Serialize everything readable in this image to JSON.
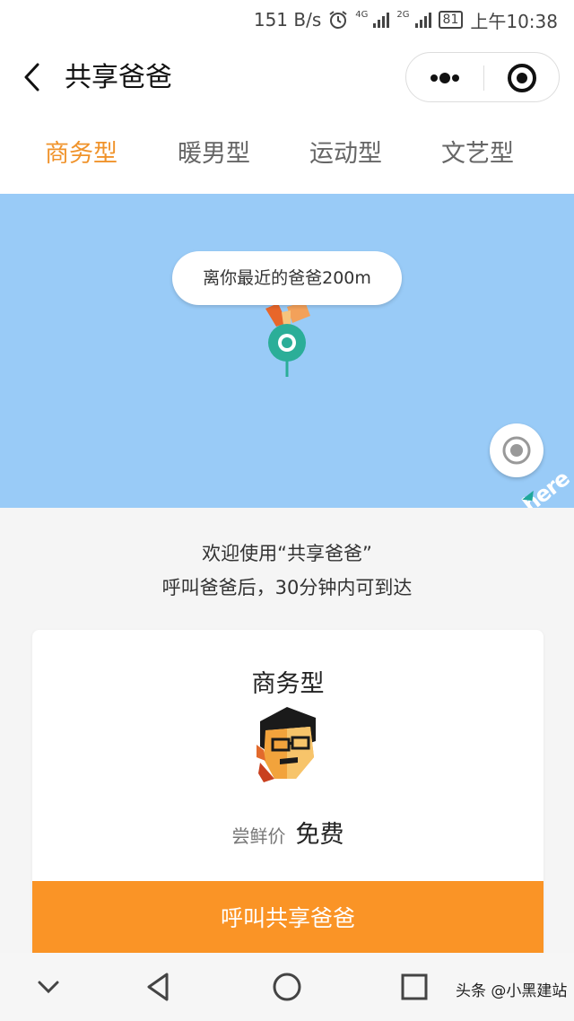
{
  "status_bar": {
    "speed": "151 B/s",
    "net1": "4G",
    "net2": "2G",
    "battery": "81",
    "time": "上午10:38"
  },
  "header": {
    "title": "共享爸爸",
    "icons": [
      "back-icon",
      "more-icon",
      "target-icon"
    ]
  },
  "tabs": [
    {
      "label": "商务型",
      "active": true
    },
    {
      "label": "暖男型",
      "active": false
    },
    {
      "label": "运动型",
      "active": false
    },
    {
      "label": "文艺型",
      "active": false
    }
  ],
  "map": {
    "bubble_text": "离你最近的爸爸200m",
    "logo_text": "here",
    "background_color": "#99cbf7",
    "marker_color": "#2bae98"
  },
  "welcome": {
    "line1": "欢迎使用“共享爸爸”",
    "line2": "呼叫爸爸后，30分钟内可到达"
  },
  "card": {
    "type_label": "商务型",
    "price_label": "尝鲜价",
    "price_value": "免费",
    "button_label": "呼叫共享爸爸",
    "button_color": "#fa9426"
  },
  "accent_color": "#f0932b",
  "navbar": {
    "icons": [
      "chevron-down-icon",
      "back-triangle-icon",
      "home-circle-icon",
      "recent-square-icon"
    ],
    "watermark": "头条 @小黑建站"
  }
}
